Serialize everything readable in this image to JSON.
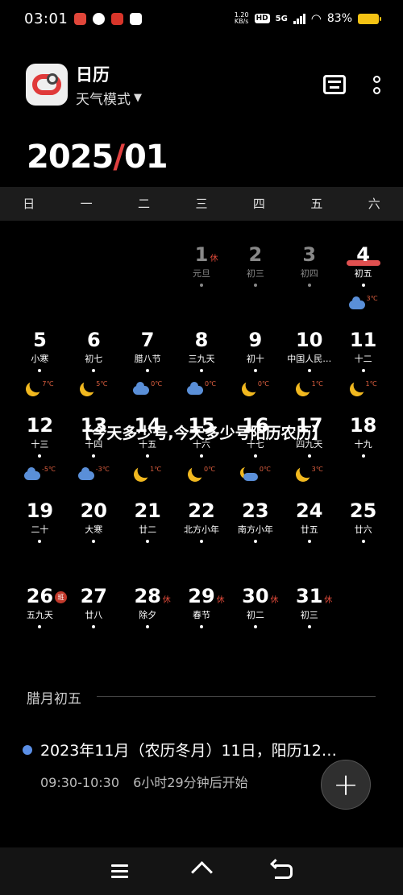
{
  "status": {
    "time": "03:01",
    "speed_top": "1.20",
    "speed_bottom": "KB/s",
    "hd": "HD",
    "network": "5G",
    "battery": "83%"
  },
  "header": {
    "app_title": "日历",
    "mode": "天气模式",
    "mode_arrow": "▼"
  },
  "year_month": {
    "year": "2025",
    "slash": "/",
    "month": "01"
  },
  "weekdays": [
    "日",
    "一",
    "二",
    "三",
    "四",
    "五",
    "六"
  ],
  "weeks": [
    [
      {
        "day": "",
        "lunar": ""
      },
      {
        "day": "",
        "lunar": ""
      },
      {
        "day": "",
        "lunar": ""
      },
      {
        "day": "1",
        "lunar": "元旦",
        "badge": "休",
        "faded": true
      },
      {
        "day": "2",
        "lunar": "初三",
        "faded": true
      },
      {
        "day": "3",
        "lunar": "初四",
        "faded": true
      },
      {
        "day": "4",
        "lunar": "初五",
        "today": true,
        "weather": "cloud",
        "temp": "3℃"
      }
    ],
    [
      {
        "day": "5",
        "lunar": "小寒",
        "weather": "moon",
        "temp": "7℃"
      },
      {
        "day": "6",
        "lunar": "初七",
        "weather": "moon",
        "temp": "5℃"
      },
      {
        "day": "7",
        "lunar": "腊八节",
        "weather": "cloud",
        "temp": "0℃"
      },
      {
        "day": "8",
        "lunar": "三九天",
        "weather": "cloud",
        "temp": "0℃"
      },
      {
        "day": "9",
        "lunar": "初十",
        "weather": "moon",
        "temp": "0℃"
      },
      {
        "day": "10",
        "lunar": "中国人民…",
        "weather": "moon",
        "temp": "1℃"
      },
      {
        "day": "11",
        "lunar": "十二",
        "weather": "moon",
        "temp": "1℃"
      }
    ],
    [
      {
        "day": "12",
        "lunar": "十三",
        "weather": "cloud",
        "temp": "-5℃"
      },
      {
        "day": "13",
        "lunar": "十四",
        "weather": "cloud",
        "temp": "-3℃"
      },
      {
        "day": "14",
        "lunar": "十五",
        "weather": "moon",
        "temp": "1℃"
      },
      {
        "day": "15",
        "lunar": "十六",
        "weather": "moon",
        "temp": "0℃"
      },
      {
        "day": "16",
        "lunar": "十七",
        "weather": "mooncloud",
        "temp": "0℃"
      },
      {
        "day": "17",
        "lunar": "四九天",
        "weather": "moon",
        "temp": "3℃"
      },
      {
        "day": "18",
        "lunar": "十九"
      }
    ],
    [
      {
        "day": "19",
        "lunar": "二十"
      },
      {
        "day": "20",
        "lunar": "大寒"
      },
      {
        "day": "21",
        "lunar": "廿二"
      },
      {
        "day": "22",
        "lunar": "北方小年"
      },
      {
        "day": "23",
        "lunar": "南方小年"
      },
      {
        "day": "24",
        "lunar": "廿五"
      },
      {
        "day": "25",
        "lunar": "廿六"
      }
    ],
    [
      {
        "day": "26",
        "lunar": "五九天",
        "badge": "班",
        "ban": true
      },
      {
        "day": "27",
        "lunar": "廿八"
      },
      {
        "day": "28",
        "lunar": "除夕",
        "badge": "休"
      },
      {
        "day": "29",
        "lunar": "春节",
        "badge": "休"
      },
      {
        "day": "30",
        "lunar": "初二",
        "badge": "休"
      },
      {
        "day": "31",
        "lunar": "初三",
        "badge": "休"
      },
      {
        "day": "",
        "lunar": ""
      }
    ]
  ],
  "overlay_text": "【今天多少号,今天多少号阳历农历】",
  "selected_label": "腊月初五",
  "event": {
    "title": "2023年11月（农历冬月）11日，阳历12…",
    "time": "09:30-10:30",
    "countdown": "6小时29分钟后开始"
  },
  "fab_label": "+",
  "colors": {
    "accent": "#e04040",
    "event_dot": "#5b8fe6",
    "temp": "#e06040",
    "moon": "#f1b81f",
    "cloud": "#5a8fd8"
  }
}
